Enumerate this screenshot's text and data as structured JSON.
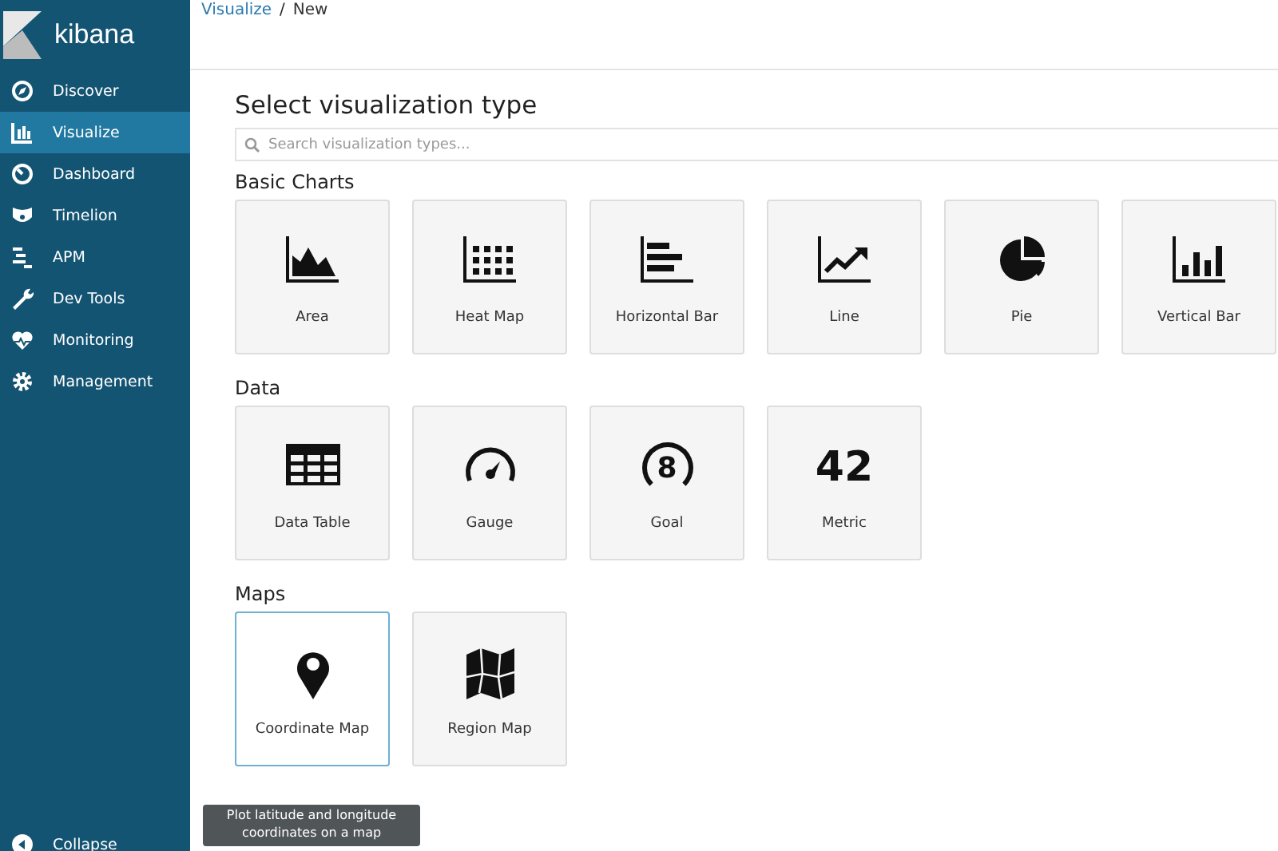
{
  "sidebar": {
    "logo": "kibana",
    "items": [
      {
        "label": "Discover",
        "selected": false
      },
      {
        "label": "Visualize",
        "selected": true
      },
      {
        "label": "Dashboard",
        "selected": false
      },
      {
        "label": "Timelion",
        "selected": false
      },
      {
        "label": "APM",
        "selected": false
      },
      {
        "label": "Dev Tools",
        "selected": false
      },
      {
        "label": "Monitoring",
        "selected": false
      },
      {
        "label": "Management",
        "selected": false
      }
    ],
    "collapse": "Collapse"
  },
  "breadcrumb": {
    "link": "Visualize",
    "separator": "/",
    "current": "New"
  },
  "title": "Select visualization type",
  "search": {
    "placeholder": "Search visualization types..."
  },
  "sections": [
    {
      "heading": "Basic Charts",
      "cards": [
        {
          "label": "Area",
          "kind": "area",
          "selected": false
        },
        {
          "label": "Heat Map",
          "kind": "heatmap",
          "selected": false
        },
        {
          "label": "Horizontal Bar",
          "kind": "hbar",
          "selected": false
        },
        {
          "label": "Line",
          "kind": "line",
          "selected": false
        },
        {
          "label": "Pie",
          "kind": "pie",
          "selected": false
        },
        {
          "label": "Vertical Bar",
          "kind": "vbar",
          "selected": false
        }
      ]
    },
    {
      "heading": "Data",
      "cards": [
        {
          "label": "Data Table",
          "kind": "table",
          "selected": false
        },
        {
          "label": "Gauge",
          "kind": "gauge",
          "selected": false
        },
        {
          "label": "Goal",
          "kind": "goal",
          "glyph": "8",
          "selected": false
        },
        {
          "label": "Metric",
          "kind": "number",
          "glyph": "42",
          "selected": false
        }
      ]
    },
    {
      "heading": "Maps",
      "cards": [
        {
          "label": "Coordinate Map",
          "kind": "pin",
          "selected": true
        },
        {
          "label": "Region Map",
          "kind": "map",
          "selected": false
        }
      ]
    }
  ],
  "tooltip": "Plot latitude and longitude coordinates on a map"
}
